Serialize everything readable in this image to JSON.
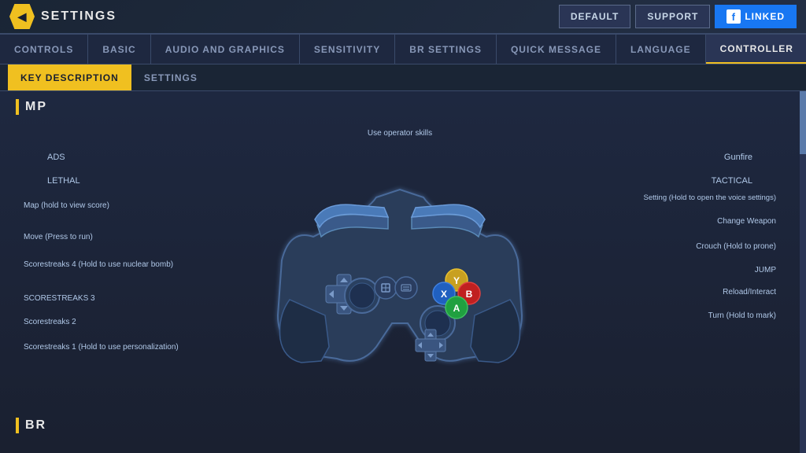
{
  "header": {
    "logo_text": "SETTINGS",
    "buttons": {
      "default": "DEFAULT",
      "support": "SUPPORT",
      "linked": "LINKED"
    }
  },
  "tabs": [
    {
      "id": "controls",
      "label": "CONTROLS",
      "active": false
    },
    {
      "id": "basic",
      "label": "BASIC",
      "active": false
    },
    {
      "id": "audio-graphics",
      "label": "AUDIO AND GRAPHICS",
      "active": false
    },
    {
      "id": "sensitivity",
      "label": "SENSITIVITY",
      "active": false
    },
    {
      "id": "br-settings",
      "label": "BR SETTINGS",
      "active": false
    },
    {
      "id": "quick-message",
      "label": "QUICK MESSAGE",
      "active": false
    },
    {
      "id": "language",
      "label": "LANGUAGE",
      "active": false
    },
    {
      "id": "controller",
      "label": "CONTROLLER",
      "active": true
    }
  ],
  "sub_tabs": [
    {
      "id": "key-description",
      "label": "KEY DESCRIPTION",
      "active": true
    },
    {
      "id": "settings",
      "label": "SETTINGS",
      "active": false
    }
  ],
  "section": {
    "title": "MP"
  },
  "controller_labels": {
    "left": {
      "ads": "ADS",
      "lethal": "LETHAL",
      "map": "Map (hold to view score)",
      "move": "Move (Press to run)",
      "scorestreaks4": "Scorestreaks 4 (Hold to use nuclear bomb)",
      "scorestreaks3": "SCORESTREAKS 3",
      "scorestreaks2": "Scorestreaks 2",
      "scorestreaks1": "Scorestreaks 1 (Hold to use personalization)"
    },
    "top": {
      "operator": "Use operator skills"
    },
    "right": {
      "gunfire": "Gunfire",
      "tactical": "TACTICAL",
      "setting": "Setting (Hold to open the voice settings)",
      "change_weapon": "Change Weapon",
      "crouch": "Crouch (Hold to prone)",
      "jump": "JUMP",
      "reload": "Reload/Interact",
      "turn": "Turn (Hold to mark)"
    }
  },
  "bottom_section": {
    "title": "BR"
  }
}
